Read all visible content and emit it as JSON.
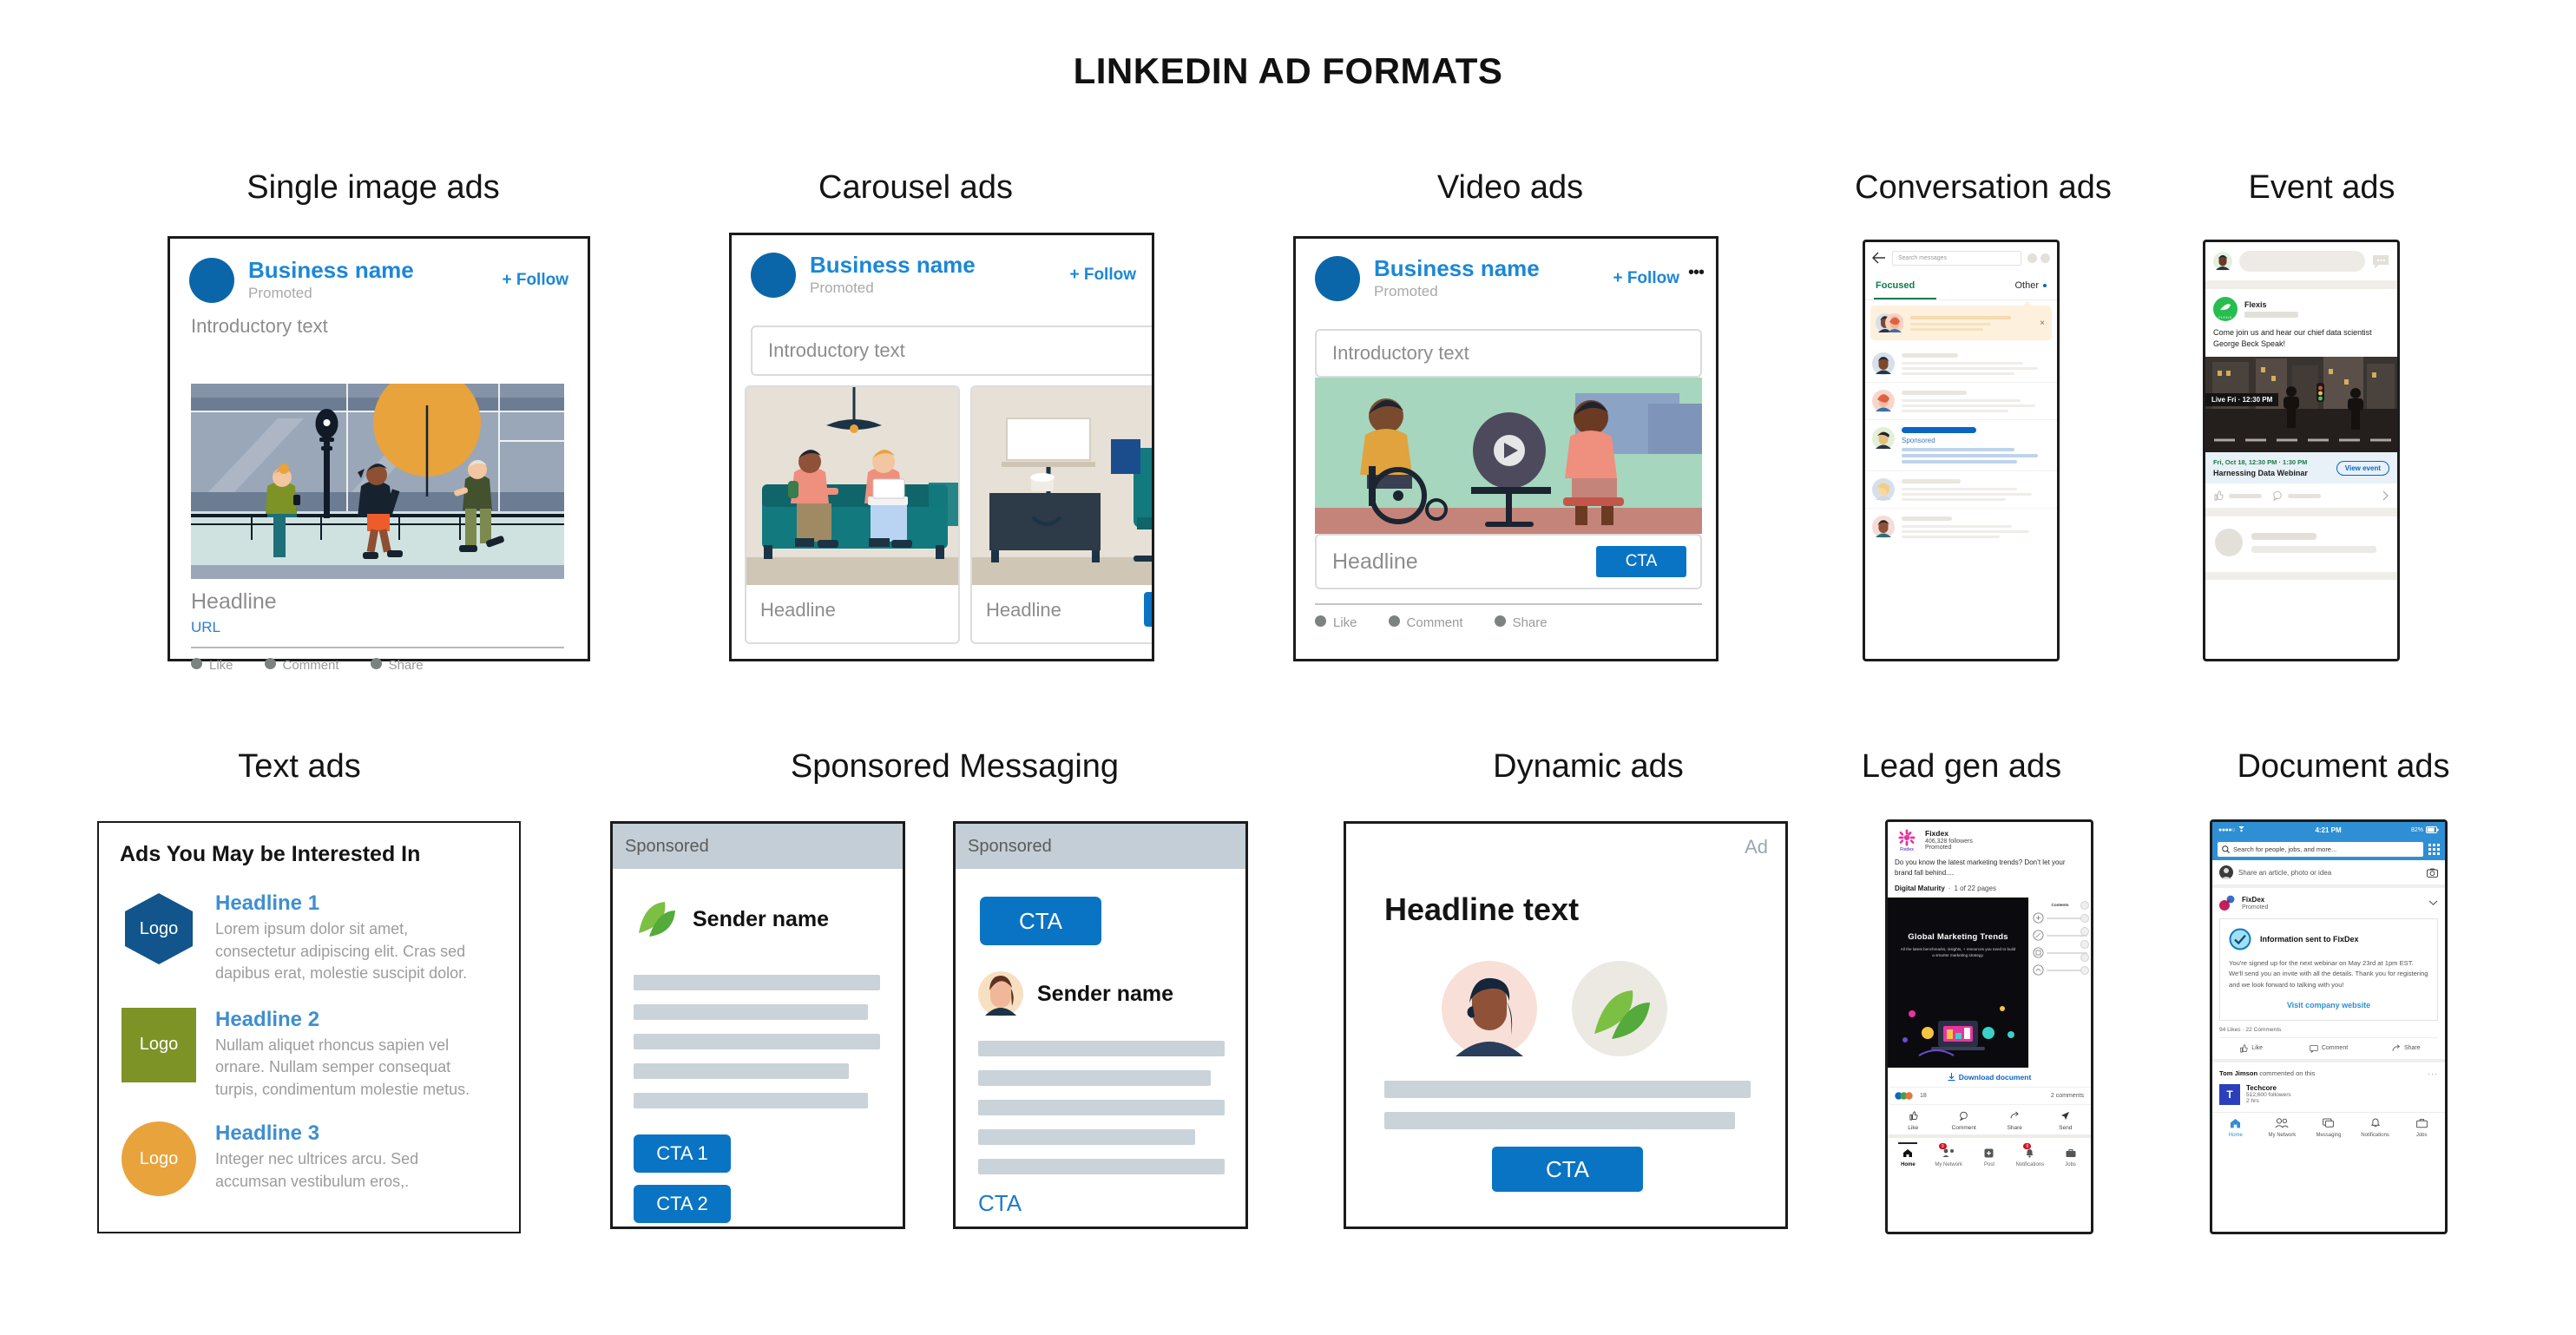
{
  "page": {
    "title": "LINKEDIN AD FORMATS"
  },
  "colors": {
    "linkedin_blue": "#0a74c4",
    "link_blue": "#1c87d6",
    "green_accent": "#1f9d55",
    "orange_accent": "#e8a33d",
    "olive": "#7d9326",
    "grey_text": "#9a9a9a"
  },
  "cards": {
    "single_image": {
      "title": "Single image ads",
      "business_name": "Business name",
      "promoted": "Promoted",
      "follow": "+ Follow",
      "intro": "Introductory text",
      "headline": "Headline",
      "url": "URL",
      "actions": [
        "Like",
        "Comment",
        "Share"
      ]
    },
    "carousel": {
      "title": "Carousel ads",
      "business_name": "Business name",
      "promoted": "Promoted",
      "follow": "+ Follow",
      "intro": "Introductory text",
      "slides": [
        {
          "headline": "Headline"
        },
        {
          "headline": "Headline"
        }
      ]
    },
    "video": {
      "title": "Video ads",
      "business_name": "Business name",
      "promoted": "Promoted",
      "follow": "+ Follow",
      "more": "•••",
      "intro": "Introductory text",
      "headline": "Headline",
      "cta": "CTA",
      "actions": [
        "Like",
        "Comment",
        "Share"
      ]
    },
    "conversation": {
      "title": "Conversation ads",
      "search_placeholder": "Search messages",
      "tab_focused": "Focused",
      "tab_other": "Other",
      "sponsored_label": "Sponsored",
      "close": "×"
    },
    "event": {
      "title": "Event ads",
      "company": "Flexis",
      "logo_text": "FLEXIS",
      "body": "Come join us and hear our chief  data scientist George Beck Speak!",
      "live_badge": "Live Fri · 12:30 PM",
      "event_datetime": "Fri, Oct 18, 12:30 PM · 1:30 PM",
      "event_name": "Harnessing Data Webinar",
      "view_event": "View event"
    },
    "text_ads": {
      "title": "Text ads",
      "header": "Ads You May be Interested In",
      "items": [
        {
          "logo": "Logo",
          "logo_shape": "hexagon",
          "logo_color": "#11558c",
          "headline": "Headline 1",
          "body": "Lorem ipsum dolor sit amet, consectetur adipiscing elit. Cras sed dapibus erat, molestie suscipit dolor."
        },
        {
          "logo": "Logo",
          "logo_shape": "square",
          "logo_color": "#7d9326",
          "headline": "Headline 2",
          "body": "Nullam aliquet rhoncus sapien vel ornare. Nullam semper consequat turpis, condimentum molestie metus."
        },
        {
          "logo": "Logo",
          "logo_shape": "circle",
          "logo_color": "#e8a33d",
          "headline": "Headline 3",
          "body": "Integer nec ultrices arcu. Sed accumsan vestibulum eros,."
        }
      ]
    },
    "sponsored_messaging": {
      "title": "Sponsored Messaging",
      "panel_left": {
        "sponsored": "Sponsored",
        "sender": "Sender name",
        "cta1": "CTA 1",
        "cta2": "CTA 2"
      },
      "panel_right": {
        "sponsored": "Sponsored",
        "cta_top": "CTA",
        "sender": "Sender name",
        "cta_link": "CTA"
      }
    },
    "dynamic": {
      "title": "Dynamic ads",
      "ad_label": "Ad",
      "headline": "Headline text",
      "cta": "CTA"
    },
    "lead_gen": {
      "title": "Lead gen ads",
      "company": "Fixdex",
      "logo_text": "Fixdex",
      "followers": "406,328 followers",
      "promoted": "Promoted",
      "body": "Do you know the latest marketing trends? Don’t let your brand fall behind....",
      "doc_title": "Digital Maturity",
      "doc_pages": "1 of 22 pages",
      "slide_title": "Global Marketing Trends",
      "slide_sub": "All the latest benchmarks, insights, + resources you need to build a smarter marketing strategy.",
      "slide_contents": "Contents",
      "download": "Download document",
      "reactions": "18",
      "comments": "2 comments",
      "actions": [
        "Like",
        "Comment",
        "Share",
        "Send"
      ],
      "nav": [
        "Home",
        "My Network",
        "Post",
        "Notifications",
        "Jobs"
      ],
      "nav_badges": [
        "",
        "9",
        "",
        "9",
        ""
      ]
    },
    "document": {
      "title": "Document ads",
      "status_time": "4:21 PM",
      "status_battery": "82%",
      "search_placeholder": "Search for people, jobs, and more...",
      "share_prompt": "Share an article, photo or idea",
      "company": "FixDex",
      "promoted": "Promoted",
      "confirm_title": "Information sent to FixDex",
      "confirm_body": "You're signed up for the next webinar on May 23rd at 1pm EST. We'll send you an invite with all the details. Thank you for registering and we look forward to talking with you!",
      "visit_link": "Visit company website",
      "stats": "94 Likes · 22 Comments",
      "actions": [
        "Like",
        "Comment",
        "Share"
      ],
      "comment_line_name": "Tom Jimson",
      "comment_line_rest": " commented on this",
      "comment_company": "Techcore",
      "comment_followers": "512,600 followers",
      "comment_time": "2 hrs",
      "comment_logo": "T",
      "nav": [
        "Home",
        "My Network",
        "Messaging",
        "Notifications",
        "Jobs"
      ]
    }
  }
}
